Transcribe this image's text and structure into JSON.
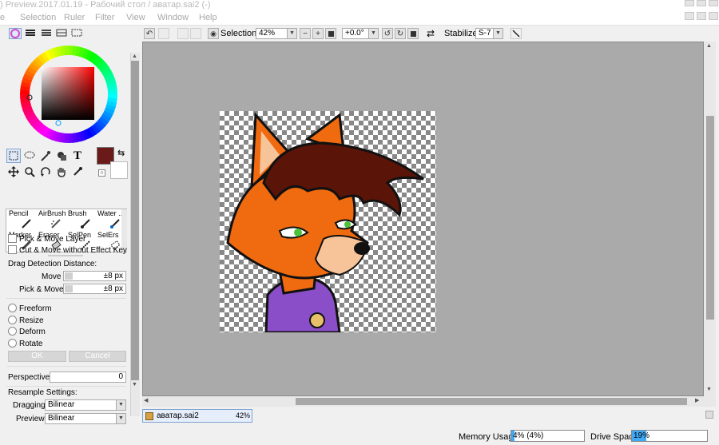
{
  "window": {
    "title": ") Preview.2017.01.19 - Рабочий стол / аватар.sai2 (-)"
  },
  "menu": {
    "items": [
      "e",
      "Selection",
      "Ruler",
      "Filter",
      "View",
      "Window",
      "Help"
    ]
  },
  "color": {
    "current_hex": "#6b1a1a",
    "secondary_hex": "#ffffff"
  },
  "brushes": [
    {
      "label": "Pencil"
    },
    {
      "label": "AirBrush"
    },
    {
      "label": "Brush"
    },
    {
      "label": "Water ..."
    },
    {
      "label": "Marker"
    },
    {
      "label": "Eraser"
    },
    {
      "label": "SelPen"
    },
    {
      "label": "SelErs"
    }
  ],
  "options": {
    "pick_move_layer": "Pick & Move Layer",
    "cut_move": "Cut & Move without Effect Key",
    "drag_detection": "Drag Detection Distance:",
    "move_label": "Move",
    "move_value": "±8 px",
    "pick_move_label": "Pick & Move",
    "pick_move_value": "±8 px",
    "freeform": "Freeform",
    "resize": "Resize",
    "deform": "Deform",
    "rotate": "Rotate",
    "ok": "OK",
    "cancel": "Cancel",
    "perspective_label": "Perspective",
    "perspective_value": "0",
    "resample_label": "Resample Settings:",
    "dragging_label": "Dragging",
    "dragging_value": "Bilinear",
    "preview_label": "Preview",
    "preview_value": "Bilinear"
  },
  "toolbar": {
    "selection_label": "Selection",
    "zoom": "42%",
    "rotation": "+0.0°",
    "stabilizer_label": "Stabilizer",
    "stabilizer_value": "S-7"
  },
  "document": {
    "tab_name": "аватар.sai2",
    "tab_zoom": "42%"
  },
  "status": {
    "memory_label": "Memory Usage",
    "memory_value": "4% (4%)",
    "memory_fraction": 0.04,
    "drive_label": "Drive Space",
    "drive_value": "19%",
    "drive_fraction": 0.19
  }
}
